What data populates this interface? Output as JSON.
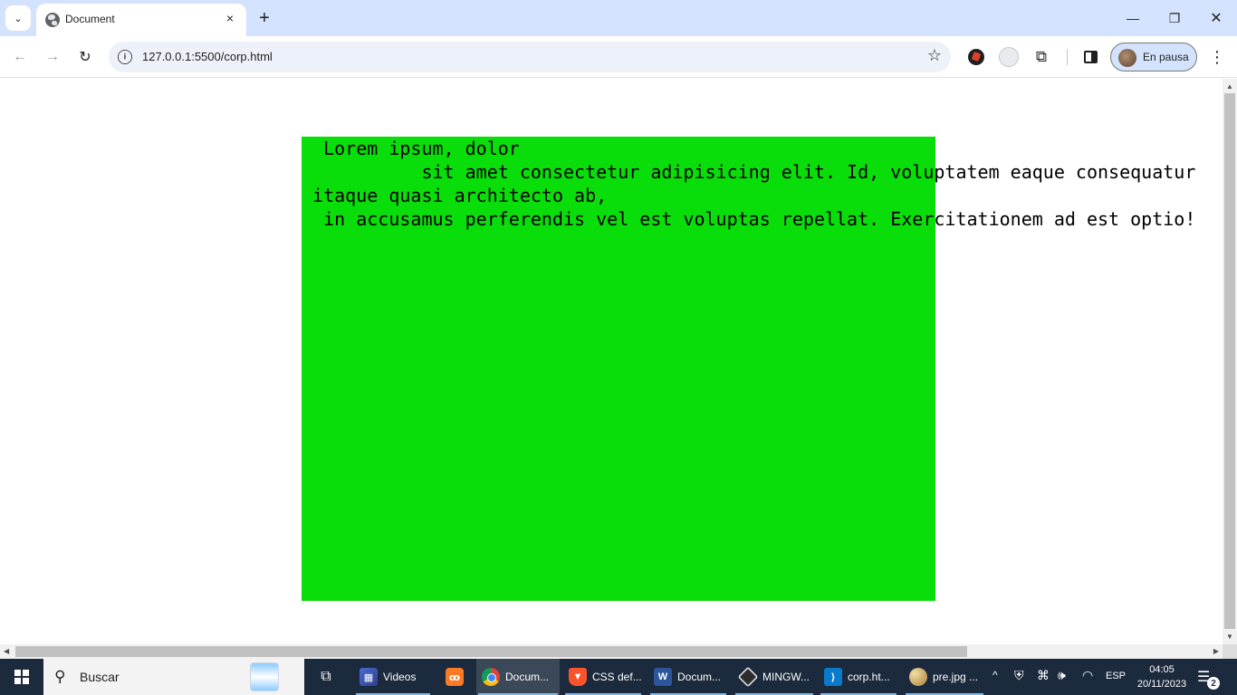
{
  "browser": {
    "tab": {
      "title": "Document",
      "close_icon": "×"
    },
    "new_tab_icon": "+",
    "tab_search_icon": "⌄",
    "window_controls": {
      "minimize": "—",
      "maximize": "❐",
      "close": "✕"
    },
    "toolbar": {
      "back_icon": "←",
      "forward_icon": "→",
      "reload_icon": "↻",
      "site_info_icon": "i",
      "url": "127.0.0.1:5500/corp.html",
      "star_icon": "☆",
      "extensions_icon": "⧉",
      "menu_icon": "⋮",
      "profile_label": "En pausa"
    }
  },
  "page": {
    "lorem_lines": [
      "  Lorem ipsum, dolor",
      "           sit amet consectetur adipisicing elit. Id, voluptatem eaque consequatur",
      " itaque quasi architecto ab,",
      "  in accusamus perferendis vel est voluptas repellat. Exercitationem ad est optio!"
    ],
    "box_color": "#0ade0a"
  },
  "scrollbars": {
    "up": "▲",
    "down": "▼",
    "left": "◀",
    "right": "▶"
  },
  "taskbar": {
    "search_text": "Buscar",
    "search_icon": "⚲",
    "taskview_icon": "⧉",
    "items": [
      {
        "label": "Videos",
        "icon": "folder-videos-icon",
        "glyph": "▦"
      },
      {
        "label": "",
        "icon": "xampp-icon",
        "glyph": "ꝏ"
      },
      {
        "label": "Docum...",
        "icon": "chrome-icon",
        "glyph": ""
      },
      {
        "label": "CSS def...",
        "icon": "brave-icon",
        "glyph": "▼"
      },
      {
        "label": "Docum...",
        "icon": "word-icon",
        "glyph": "W"
      },
      {
        "label": "MINGW...",
        "icon": "git-bash-icon",
        "glyph": ""
      },
      {
        "label": "corp.ht...",
        "icon": "vscode-icon",
        "glyph": "⟩"
      },
      {
        "label": "pre.jpg ...",
        "icon": "paint-icon",
        "glyph": ""
      }
    ],
    "tray": {
      "chevron": "^",
      "lang": "ESP",
      "time": "04:05",
      "date": "20/11/2023",
      "notification_count": "2",
      "notification_icon": "☰"
    }
  }
}
